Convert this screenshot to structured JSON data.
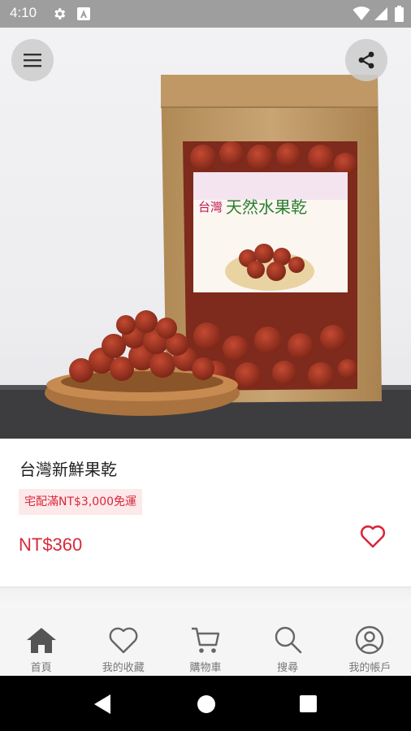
{
  "status_bar": {
    "time": "4:10",
    "icons": [
      "gear-icon",
      "a-box-icon",
      "wifi-icon",
      "signal-icon",
      "battery-icon"
    ]
  },
  "hero": {
    "package_text": {
      "brand": "台灣",
      "product": "天然水果乾"
    }
  },
  "product": {
    "name": "台灣新鮮果乾",
    "promo": "宅配滿NT$3,000免運",
    "price": "NT$360"
  },
  "bottom_nav": {
    "items": [
      {
        "label": "首頁",
        "icon": "home-icon",
        "active": true
      },
      {
        "label": "我的收藏",
        "icon": "heart-icon",
        "active": false
      },
      {
        "label": "購物車",
        "icon": "cart-icon",
        "active": false
      },
      {
        "label": "搜尋",
        "icon": "search-icon",
        "active": false
      },
      {
        "label": "我的帳戶",
        "icon": "account-icon",
        "active": false
      }
    ]
  },
  "colors": {
    "accent_red": "#d8283a",
    "promo_bg": "#fde8ea",
    "nav_active": "#555555",
    "nav_inactive": "#777777"
  }
}
